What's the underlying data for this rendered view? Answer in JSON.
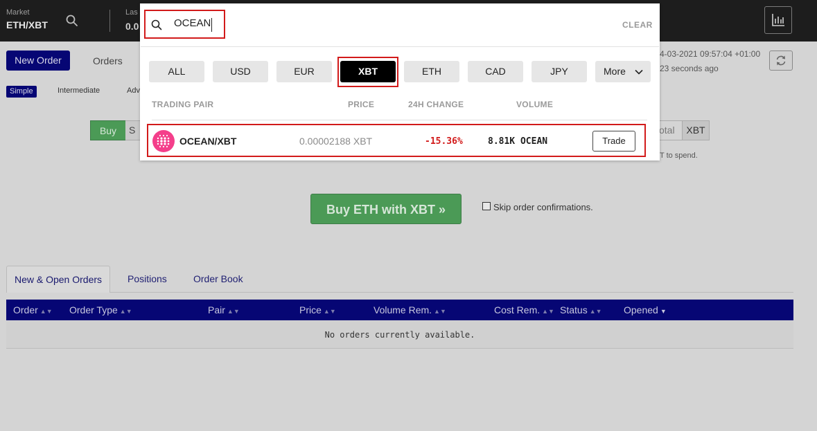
{
  "header": {
    "market_label": "Market",
    "market_pair": "ETH/XBT",
    "last_label": "Las",
    "last_value": "0.0",
    "icons": {
      "search": "search-icon",
      "chart": "bar-chart-icon"
    }
  },
  "subheader": {
    "new_order_label": "New Order",
    "orders_label": "Orders",
    "modes": [
      "Simple",
      "Intermediate",
      "Adv"
    ],
    "timestamp": "4-03-2021 09:57:04 +01:00",
    "updated_ago": "23 seconds ago",
    "refresh_icon": "refresh-icon"
  },
  "order_form": {
    "buy_label": "Buy",
    "sell_label": "S",
    "total_label": "otal",
    "currency_label": "XBT",
    "spend_hint": "T to spend.",
    "submit_label": "Buy ETH with XBT »",
    "skip_label": "Skip order confirmations.",
    "skip_checked": false
  },
  "orders_section": {
    "tabs": [
      "New & Open Orders",
      "Positions",
      "Order Book"
    ],
    "active_tab": "New & Open Orders",
    "columns": [
      "Order",
      "Order Type",
      "Pair",
      "Price",
      "Volume Rem.",
      "Cost Rem.",
      "Status",
      "Opened"
    ],
    "empty_message": "No orders currently available."
  },
  "pair_search": {
    "query": "OCEAN",
    "clear_label": "CLEAR",
    "filters": [
      "ALL",
      "USD",
      "EUR",
      "XBT",
      "ETH",
      "CAD",
      "JPY"
    ],
    "active_filter": "XBT",
    "more_label": "More",
    "columns": {
      "pair": "TRADING PAIR",
      "price": "PRICE",
      "change": "24H CHANGE",
      "volume": "VOLUME"
    },
    "results": [
      {
        "pair": "OCEAN/XBT",
        "price": "0.00002188 XBT",
        "change": "-15.36%",
        "volume": "8.81K OCEAN",
        "action": "Trade",
        "icon": "ocean-protocol-logo"
      }
    ],
    "colors": {
      "negative": "#d21a1a",
      "highlight": "#d21a1a",
      "active_filter_bg": "#000000"
    }
  },
  "theme": {
    "primary": "#060674",
    "buy": "#4b9a56",
    "topbar": "#1d1d1d"
  }
}
